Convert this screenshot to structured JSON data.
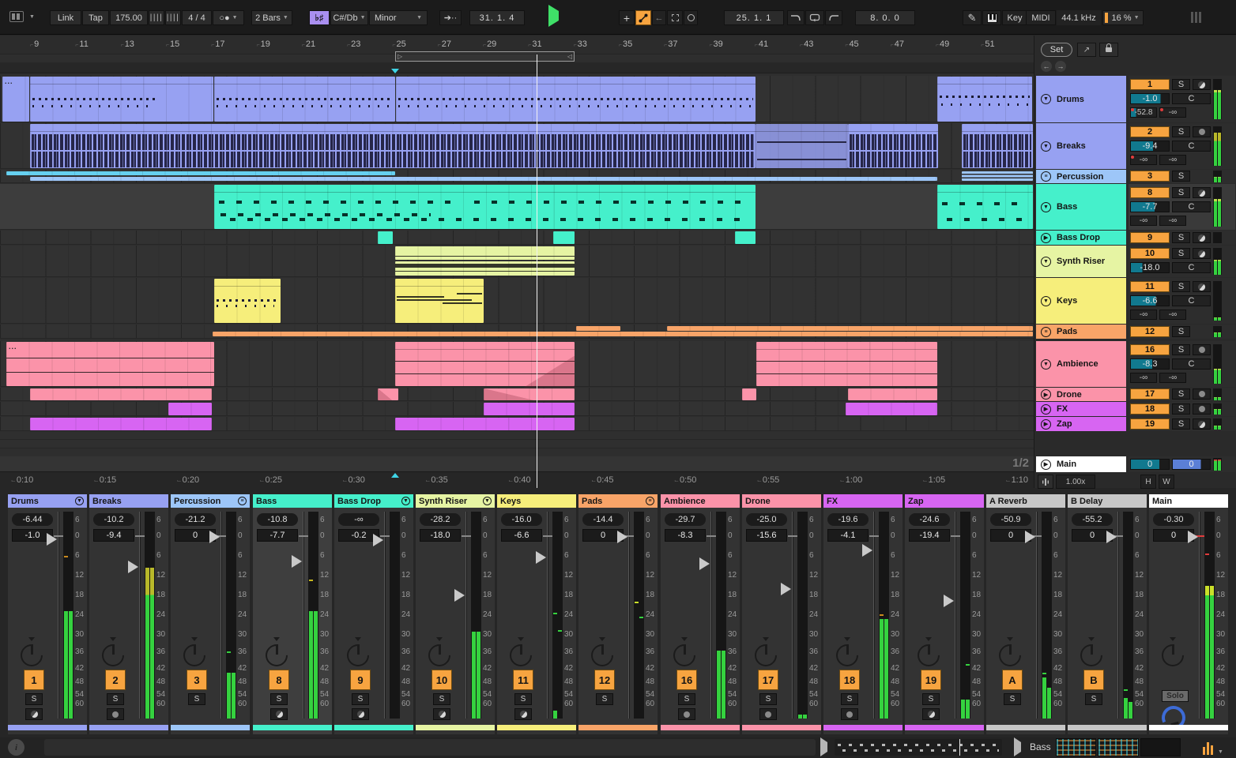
{
  "palette": {
    "accent_orange": "#f7a440",
    "teal_value": "#11798f",
    "pan_blue": "#5b7fd6",
    "play_green": "#3fe068",
    "scale_purple": "#a98ff0",
    "meter_green": "#35d23f",
    "clip_red": "#e03c3c",
    "insert_marker_cyan": "#3fd4e6",
    "drums": "#97a1f2",
    "percussion": "#9dc6f8",
    "bass": "#45f0cb",
    "synth_riser": "#e6f4a3",
    "keys": "#f6ee7b",
    "pads": "#f8a468",
    "ambience": "#fb93a9",
    "fx": "#d765f2",
    "return": "#c7c7c7",
    "main": "#ffffff"
  },
  "toolbar": {
    "link": "Link",
    "tap": "Tap",
    "tempo": "175.00",
    "time_sig": "4 / 4",
    "quantize": "2 Bars",
    "scale_icon": "♭♯",
    "scale_root": "C#/Db",
    "scale_name": "Minor",
    "arrangement_position": "31.  1.  4",
    "punch_position": "25.  1.  1",
    "loop_length": "8.  0.  0",
    "key_label": "Key",
    "midi_label": "MIDI",
    "sample_rate": "44.1 kHz",
    "cpu": "16 %"
  },
  "arrangement": {
    "bar_numbers": [
      "9",
      "11",
      "13",
      "15",
      "17",
      "19",
      "21",
      "23",
      "25",
      "27",
      "29",
      "31",
      "33",
      "35",
      "37",
      "39",
      "41",
      "43",
      "45",
      "47",
      "49",
      "51"
    ],
    "time_labels": [
      "0:10",
      "0:15",
      "0:20",
      "0:25",
      "0:30",
      "0:35",
      "0:40",
      "0:45",
      "0:50",
      "0:55",
      "1:00",
      "1:05",
      "1:10"
    ],
    "loop_left_glyph": "▷",
    "loop_right_glyph": "◁",
    "clip_ellipsis": "...",
    "page_indicator": "1/2"
  },
  "panel": {
    "set_label": "Set",
    "back_arrow": "←",
    "fwd_arrow": "→",
    "zoom_factor": "1.00x",
    "h_label": "H",
    "w_label": "W"
  },
  "tracks": {
    "drums": {
      "name": "Drums",
      "number": "1",
      "solo": "S",
      "volume": "-1.0",
      "pan": "C",
      "send_a": "-52.8",
      "send_b": "-∞"
    },
    "breaks": {
      "name": "Breaks",
      "number": "2",
      "solo": "S",
      "volume": "-9.4",
      "pan": "C",
      "send_a": "-∞",
      "send_b": "-∞"
    },
    "percussion": {
      "name": "Percussion",
      "number": "3",
      "solo": "S"
    },
    "bass": {
      "name": "Bass",
      "number": "8",
      "solo": "S",
      "volume": "-7.7",
      "pan": "C",
      "send_a": "-∞",
      "send_b": "-∞"
    },
    "bass_drop": {
      "name": "Bass Drop",
      "number": "9",
      "solo": "S"
    },
    "synth_riser": {
      "name": "Synth Riser",
      "number": "10",
      "solo": "S",
      "volume": "-18.0",
      "pan": "C"
    },
    "keys": {
      "name": "Keys",
      "number": "11",
      "solo": "S",
      "volume": "-6.6",
      "pan": "C",
      "send_a": "-∞",
      "send_b": "-∞"
    },
    "pads": {
      "name": "Pads",
      "number": "12",
      "solo": "S"
    },
    "ambience": {
      "name": "Ambience",
      "number": "16",
      "solo": "S",
      "volume": "-8.3",
      "pan": "C",
      "send_a": "-∞",
      "send_b": "-∞"
    },
    "drone": {
      "name": "Drone",
      "number": "17",
      "solo": "S"
    },
    "fx": {
      "name": "FX",
      "number": "18",
      "solo": "S"
    },
    "zap": {
      "name": "Zap",
      "number": "19",
      "solo": "S"
    },
    "main": {
      "name": "Main",
      "volume": "0",
      "pan": "0"
    }
  },
  "mixer": {
    "meter_scale": [
      "6",
      "0",
      "6",
      "12",
      "18",
      "24",
      "30",
      "36",
      "42",
      "48",
      "54",
      "60"
    ],
    "strips": [
      {
        "name": "Drums",
        "peak": "-6.44",
        "volume": "-1.0",
        "number": "1",
        "solo": "S"
      },
      {
        "name": "Breaks",
        "peak": "-10.2",
        "volume": "-9.4",
        "number": "2",
        "solo": "S"
      },
      {
        "name": "Percussion",
        "peak": "-21.2",
        "volume": "0",
        "number": "3",
        "solo": "S"
      },
      {
        "name": "Bass",
        "peak": "-10.8",
        "volume": "-7.7",
        "number": "8",
        "solo": "S"
      },
      {
        "name": "Bass Drop",
        "peak": "-∞",
        "volume": "-0.2",
        "number": "9",
        "solo": "S"
      },
      {
        "name": "Synth Riser",
        "peak": "-28.2",
        "volume": "-18.0",
        "number": "10",
        "solo": "S"
      },
      {
        "name": "Keys",
        "peak": "-16.0",
        "volume": "-6.6",
        "number": "11",
        "solo": "S"
      },
      {
        "name": "Pads",
        "peak": "-14.4",
        "volume": "0",
        "number": "12",
        "solo": "S"
      },
      {
        "name": "Ambience",
        "peak": "-29.7",
        "volume": "-8.3",
        "number": "16",
        "solo": "S"
      },
      {
        "name": "Drone",
        "peak": "-25.0",
        "volume": "-15.6",
        "number": "17",
        "solo": "S"
      },
      {
        "name": "FX",
        "peak": "-19.6",
        "volume": "-4.1",
        "number": "18",
        "solo": "S"
      },
      {
        "name": "Zap",
        "peak": "-24.6",
        "volume": "-19.4",
        "number": "19",
        "solo": "S"
      },
      {
        "name": "A Reverb",
        "peak": "-50.9",
        "volume": "0",
        "number": "A",
        "solo": "S"
      },
      {
        "name": "B Delay",
        "peak": "-55.2",
        "volume": "0",
        "number": "B",
        "solo": "S"
      },
      {
        "name": "Main",
        "peak": "-0.30",
        "volume": "0",
        "solo_label": "Solo"
      }
    ]
  },
  "status_bar": {
    "clip_name": "Bass"
  }
}
